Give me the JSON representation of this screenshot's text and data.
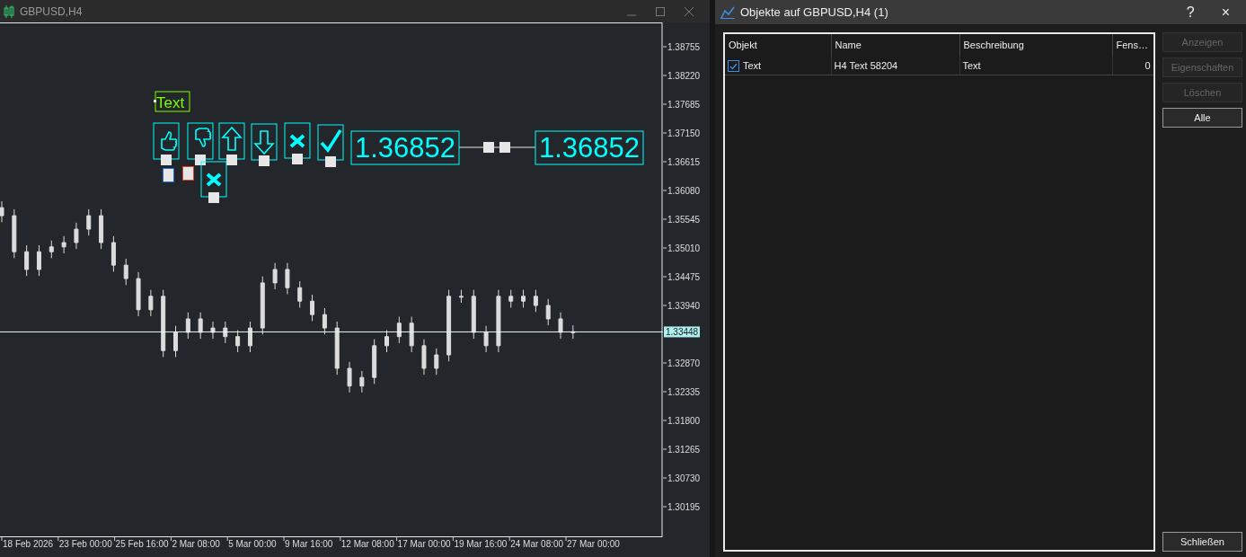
{
  "chart_window": {
    "title": "GBPUSD,H4",
    "price_axis": [
      "1.38755",
      "1.38220",
      "1.37685",
      "1.37150",
      "1.36615",
      "1.36080",
      "1.35545",
      "1.35010",
      "1.34475",
      "1.33940",
      "1.32870",
      "1.32335",
      "1.31800",
      "1.31265",
      "1.30730",
      "1.30195"
    ],
    "time_axis": [
      "18 Feb 2026",
      "23 Feb 00:00",
      "25 Feb 16:00",
      "2 Mar 08:00",
      "5 Mar 00:00",
      "9 Mar 16:00",
      "12 Mar 08:00",
      "17 Mar 00:00",
      "19 Mar 16:00",
      "24 Mar 08:00",
      "27 Mar 00:00"
    ],
    "current_price": "1.33448",
    "objects": [
      {
        "kind": "text",
        "text": "Text"
      },
      {
        "kind": "thumbs_up"
      },
      {
        "kind": "thumbs_down"
      },
      {
        "kind": "arrow_up"
      },
      {
        "kind": "arrow_down"
      },
      {
        "kind": "stop"
      },
      {
        "kind": "check"
      },
      {
        "kind": "price_label",
        "text": "1.36852"
      },
      {
        "kind": "trendline"
      },
      {
        "kind": "price_label",
        "text": "1.36852"
      },
      {
        "kind": "stop"
      },
      {
        "kind": "buy_marker"
      },
      {
        "kind": "sell_marker"
      }
    ]
  },
  "dialog": {
    "title": "Objekte auf GBPUSD,H4 (1)",
    "help": "?",
    "close": "×",
    "columns": [
      "Objekt",
      "Name",
      "Beschreibung",
      "Fens…"
    ],
    "rows": [
      {
        "checked": true,
        "cells": [
          "Text",
          "H4 Text 58204",
          "Text",
          "0"
        ]
      }
    ],
    "buttons": [
      {
        "label": "Anzeigen",
        "disabled": true
      },
      {
        "label": "Eigenschaften",
        "disabled": true
      },
      {
        "label": "Löschen",
        "disabled": true
      },
      {
        "label": "Alle",
        "disabled": false
      }
    ],
    "close_button": "Schließen"
  }
}
